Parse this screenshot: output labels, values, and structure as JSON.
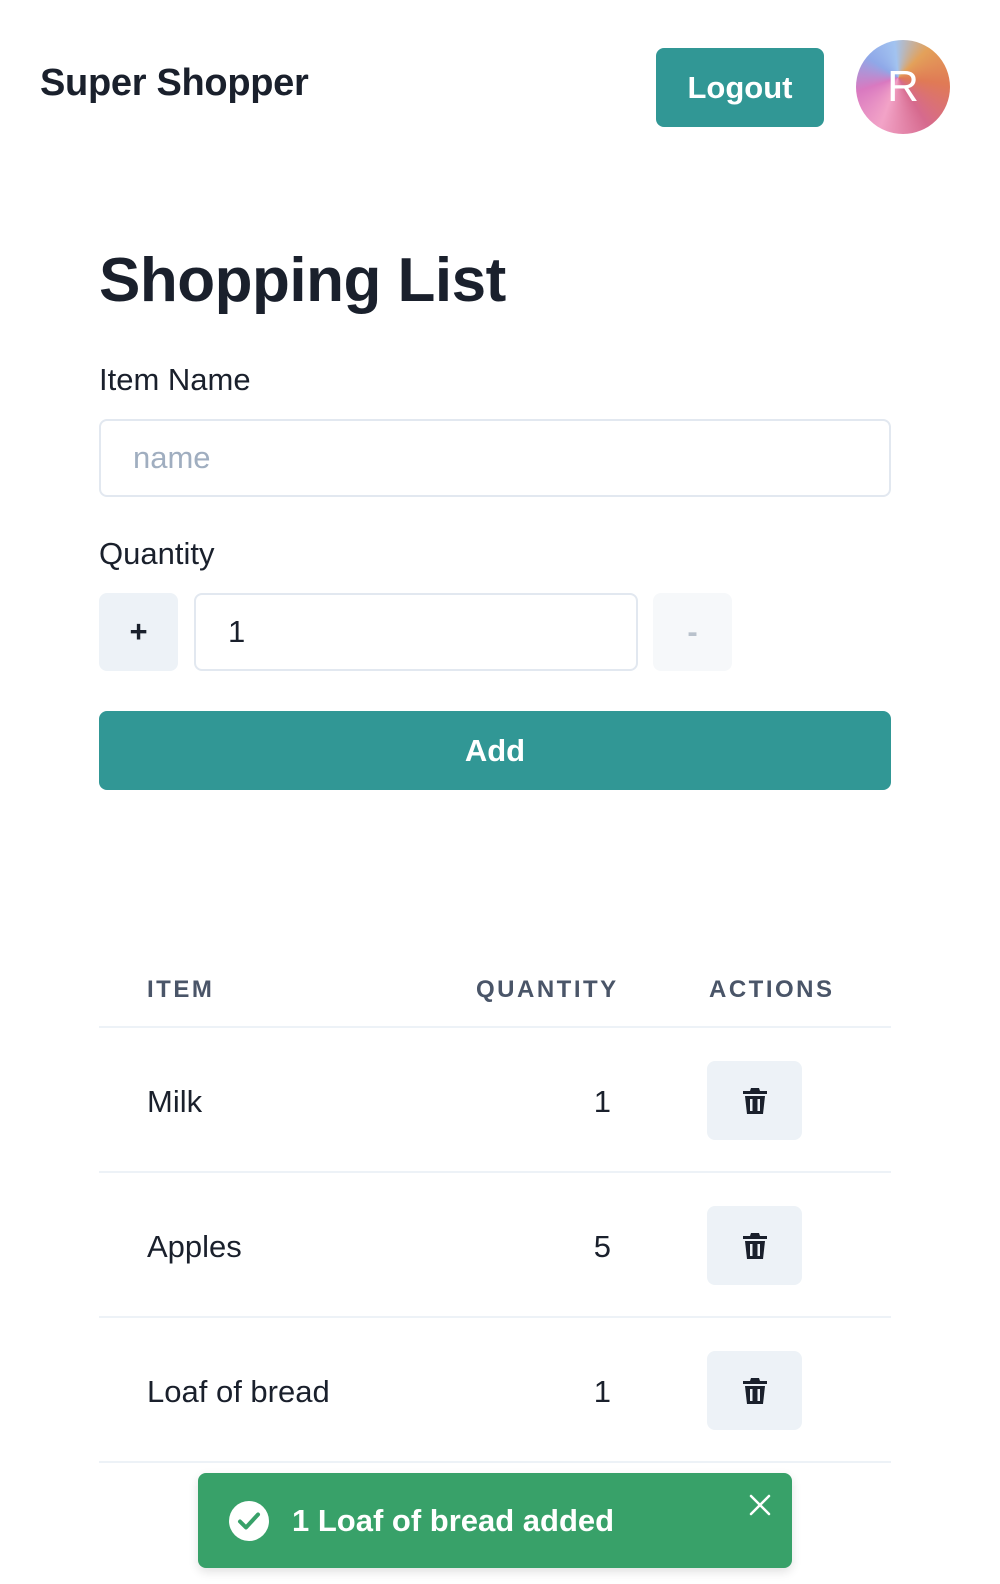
{
  "header": {
    "brand": "Super Shopper",
    "logout_label": "Logout",
    "avatar_initial": "R"
  },
  "main": {
    "title": "Shopping List",
    "item_name_label": "Item Name",
    "item_name_placeholder": "name",
    "item_name_value": "",
    "quantity_label": "Quantity",
    "quantity_value": "1",
    "plus_label": "+",
    "minus_label": "-",
    "add_label": "Add"
  },
  "table": {
    "columns": [
      "ITEM",
      "QUANTITY",
      "ACTIONS"
    ],
    "rows": [
      {
        "name": "Milk",
        "quantity": "1"
      },
      {
        "name": "Apples",
        "quantity": "5"
      },
      {
        "name": "Loaf of bread",
        "quantity": "1"
      }
    ],
    "delete_icon": "trash-icon"
  },
  "toast": {
    "message": "1 Loaf of bread added",
    "status": "success",
    "icon": "check-circle-icon",
    "close_icon": "close-icon"
  },
  "colors": {
    "primary": "#319795",
    "success": "#38a169",
    "text": "#1a202c",
    "muted_button": "#edf2f7"
  }
}
